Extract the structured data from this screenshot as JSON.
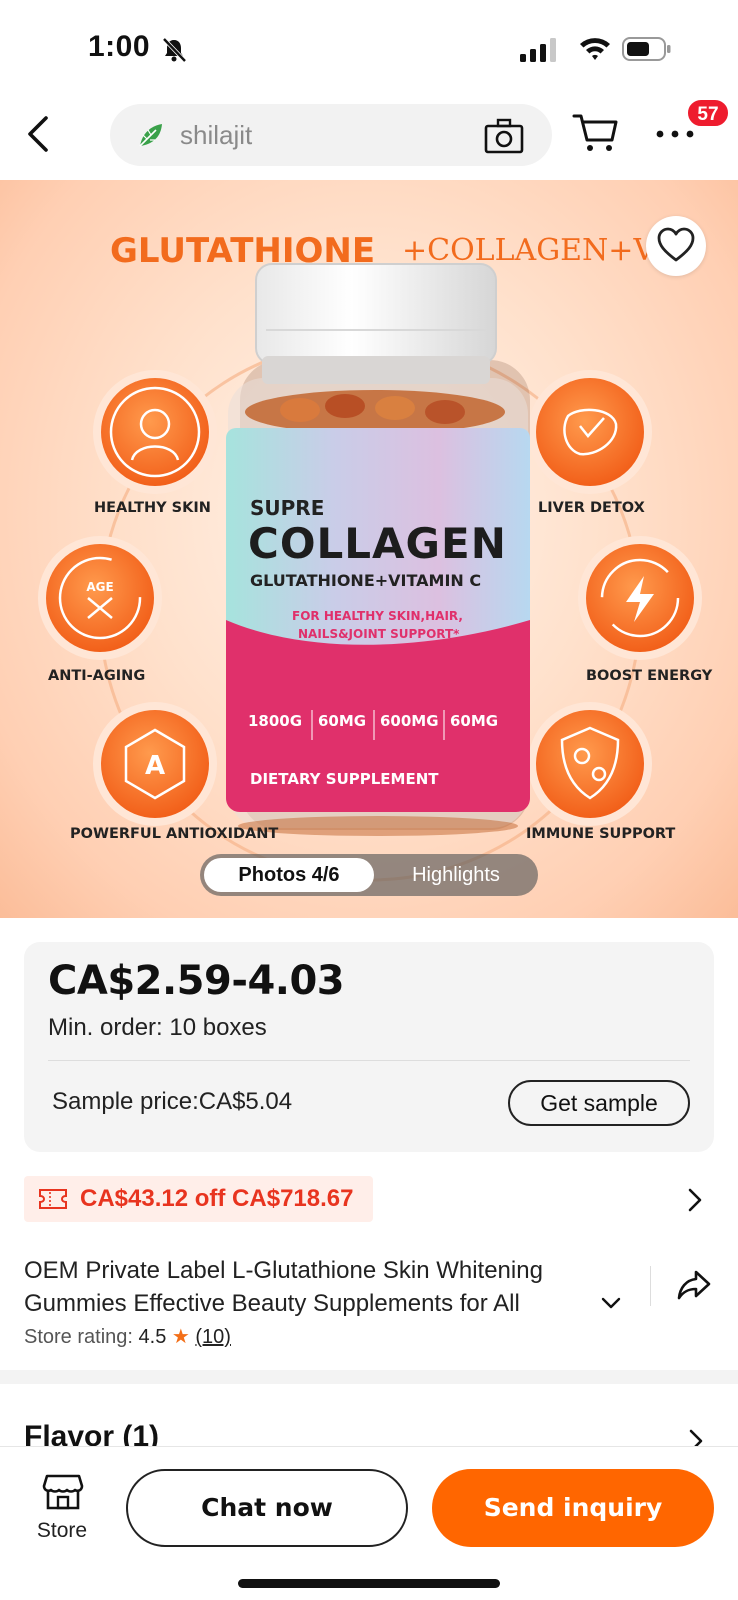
{
  "status_bar": {
    "time": "1:00"
  },
  "header": {
    "search_text": "shilajit",
    "cart_badge": "57",
    "icons": [
      "back-icon",
      "leaf-icon",
      "camera-icon",
      "cart-icon",
      "more-icon"
    ]
  },
  "hero": {
    "banner_title": "GLUTATHIONE",
    "banner_subtitle": "+COLLAGEN+V",
    "bottle": {
      "brand_line": "SUPRE",
      "product_name": "COLLAGEN",
      "formula": "GLUTATHIONE+VITAMIN C",
      "claim_line_1": "FOR HEALTHY SKIN,HAIR,",
      "claim_line_2": "NAILS&JOINT SUPPORT*",
      "doses": [
        "1800G",
        "60MG",
        "600MG",
        "60MG"
      ],
      "supplement_label": "DIETARY SUPPLEMENT"
    },
    "features": {
      "healthy_skin": "HEALTHY SKIN",
      "anti_aging": "ANTI-AGING",
      "antioxidant": "POWERFUL ANTIOXIDANT",
      "liver_detox": "LIVER DETOX",
      "boost_energy": "BOOST ENERGY",
      "immune_support": "IMMUNE SUPPORT",
      "age_badge": "AGE",
      "antioxidant_letter": "A"
    },
    "tabs": {
      "photos": "Photos 4/6",
      "highlights": "Highlights"
    }
  },
  "pricing": {
    "price_range": "CA$2.59-4.03",
    "min_order": "Min. order: 10 boxes",
    "sample_price": "Sample price:CA$5.04",
    "get_sample": "Get sample"
  },
  "coupon": {
    "text": "CA$43.12 off CA$718.67"
  },
  "product": {
    "title": "OEM Private Label L-Glutathione Skin Whitening Gummies Effective Beauty Supplements for All",
    "rating_label": "Store rating:",
    "rating_value": "4.5",
    "rating_star": "★",
    "rating_count": "(10)"
  },
  "flavor_section": {
    "label": "Flavor (1)"
  },
  "bottom_bar": {
    "store": "Store",
    "chat": "Chat now",
    "inquiry": "Send inquiry"
  },
  "colors": {
    "accent_orange": "#ff6600",
    "coupon_red": "#e8341f",
    "badge_red": "#ee1c2e",
    "hero_orange": "#f26b1d",
    "bottle_pink": "#e0306b"
  }
}
